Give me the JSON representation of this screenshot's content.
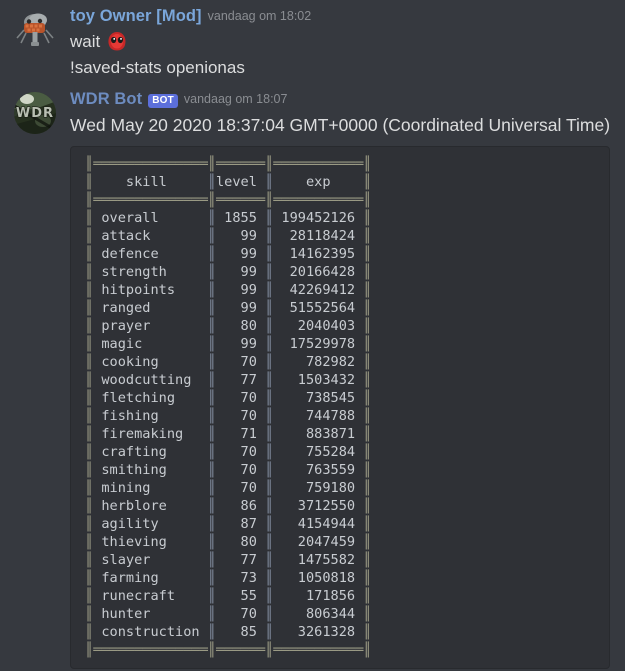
{
  "theme": {
    "bg": "#36393f",
    "codeblock_bg": "#2f3136",
    "text": "#dcddde",
    "muted": "#8a8d92",
    "author_link": "#7aa6da",
    "bot_badge_bg": "#5c6fdb",
    "mono_text": "#c8ccd1",
    "table_border": "#9a9a84"
  },
  "messages": [
    {
      "author": "toy Owner [Mod]",
      "is_bot": false,
      "timestamp": "vandaag om 18:02",
      "avatar_name": "toy-owner-avatar",
      "lines": [
        {
          "text": "wait ",
          "emoji": "red-blob-emoji"
        },
        {
          "text": "!saved-stats openionas"
        }
      ]
    },
    {
      "author": "WDR Bot",
      "is_bot": true,
      "bot_badge": "BOT",
      "timestamp": "vandaag om 18:07",
      "avatar_name": "wdr-bot-avatar",
      "date_line": "Wed May 20 2020 18:37:04 GMT+0000 (Coordinated Universal Time)"
    }
  ],
  "stats_table": {
    "headers": [
      "skill",
      "level",
      "exp"
    ],
    "rows": [
      {
        "skill": "overall",
        "level": "1855",
        "exp": "199452126"
      },
      {
        "skill": "attack",
        "level": "99",
        "exp": "28118424"
      },
      {
        "skill": "defence",
        "level": "99",
        "exp": "14162395"
      },
      {
        "skill": "strength",
        "level": "99",
        "exp": "20166428"
      },
      {
        "skill": "hitpoints",
        "level": "99",
        "exp": "42269412"
      },
      {
        "skill": "ranged",
        "level": "99",
        "exp": "51552564"
      },
      {
        "skill": "prayer",
        "level": "80",
        "exp": "2040403"
      },
      {
        "skill": "magic",
        "level": "99",
        "exp": "17529978"
      },
      {
        "skill": "cooking",
        "level": "70",
        "exp": "782982"
      },
      {
        "skill": "woodcutting",
        "level": "77",
        "exp": "1503432"
      },
      {
        "skill": "fletching",
        "level": "70",
        "exp": "738545"
      },
      {
        "skill": "fishing",
        "level": "70",
        "exp": "744788"
      },
      {
        "skill": "firemaking",
        "level": "71",
        "exp": "883871"
      },
      {
        "skill": "crafting",
        "level": "70",
        "exp": "755284"
      },
      {
        "skill": "smithing",
        "level": "70",
        "exp": "763559"
      },
      {
        "skill": "mining",
        "level": "70",
        "exp": "759180"
      },
      {
        "skill": "herblore",
        "level": "86",
        "exp": "3712550"
      },
      {
        "skill": "agility",
        "level": "87",
        "exp": "4154944"
      },
      {
        "skill": "thieving",
        "level": "80",
        "exp": "2047459"
      },
      {
        "skill": "slayer",
        "level": "77",
        "exp": "1475582"
      },
      {
        "skill": "farming",
        "level": "73",
        "exp": "1050818"
      },
      {
        "skill": "runecraft",
        "level": "55",
        "exp": "171856"
      },
      {
        "skill": "hunter",
        "level": "70",
        "exp": "806344"
      },
      {
        "skill": "construction",
        "level": "85",
        "exp": "3261328"
      }
    ],
    "col_widths": {
      "skill": 14,
      "level": 6,
      "exp": 11
    }
  }
}
